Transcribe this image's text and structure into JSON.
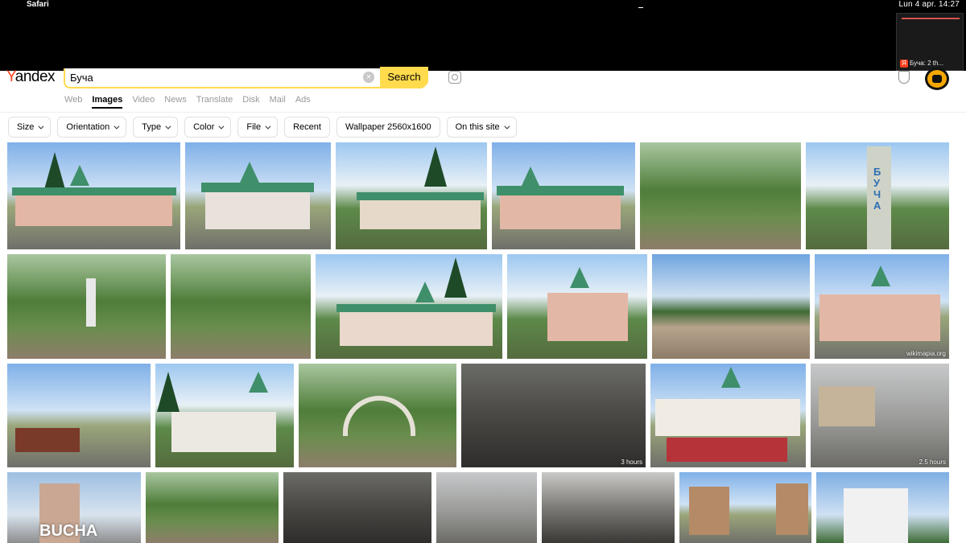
{
  "menubar": {
    "app_name": "Safari",
    "clock": "Lun 4 apr.  14:27"
  },
  "mini_window": {
    "label": "Буча: 2 th..."
  },
  "header": {
    "logo_first": "Y",
    "logo_rest": "andex",
    "search_value": "Буча",
    "search_button": "Search",
    "nav": [
      "Web",
      "Images",
      "Video",
      "News",
      "Translate",
      "Disk",
      "Mail",
      "Ads"
    ],
    "active_nav": "Images"
  },
  "filters": [
    {
      "label": "Size",
      "dropdown": true
    },
    {
      "label": "Orientation",
      "dropdown": true
    },
    {
      "label": "Type",
      "dropdown": true
    },
    {
      "label": "Color",
      "dropdown": true
    },
    {
      "label": "File",
      "dropdown": true
    },
    {
      "label": "Recent",
      "dropdown": false
    },
    {
      "label": "Wallpaper 2560x1600",
      "dropdown": false
    },
    {
      "label": "On this site",
      "dropdown": true
    }
  ],
  "results": {
    "badges": {
      "r3c4": "3 hours",
      "r3c6": "2.5 hours",
      "r2c6": "wikimapia.org"
    },
    "sign_text": {
      "bucha_sign": "BUCHA",
      "stele": "БУЧА"
    }
  }
}
